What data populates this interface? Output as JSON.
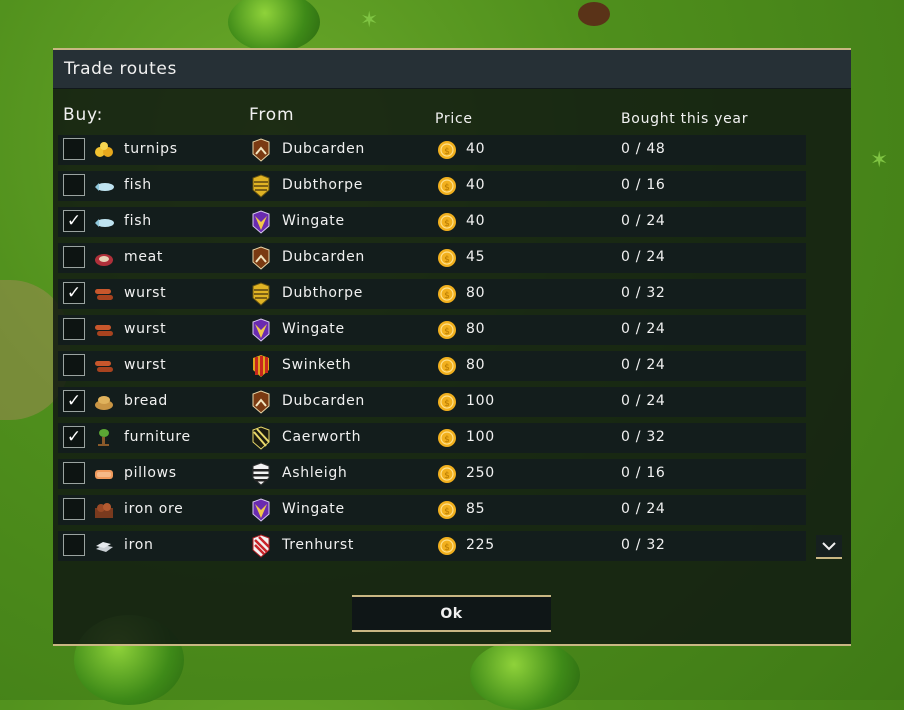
{
  "dialog": {
    "title": "Trade routes",
    "ok_label": "Ok"
  },
  "headers": {
    "buy": "Buy:",
    "from": "From",
    "price": "Price",
    "bought": "Bought this year"
  },
  "routes": [
    {
      "checked": false,
      "ware": "turnips",
      "ware_icon": "turnips-icon",
      "city": "Dubcarden",
      "crest": "dubcarden-crest",
      "price": "40",
      "bought": "0 / 48"
    },
    {
      "checked": false,
      "ware": "fish",
      "ware_icon": "fish-icon",
      "city": "Dubthorpe",
      "crest": "dubthorpe-crest",
      "price": "40",
      "bought": "0 / 16"
    },
    {
      "checked": true,
      "ware": "fish",
      "ware_icon": "fish-icon",
      "city": "Wingate",
      "crest": "wingate-crest",
      "price": "40",
      "bought": "0 / 24"
    },
    {
      "checked": false,
      "ware": "meat",
      "ware_icon": "meat-icon",
      "city": "Dubcarden",
      "crest": "dubcarden-crest",
      "price": "45",
      "bought": "0 / 24"
    },
    {
      "checked": true,
      "ware": "wurst",
      "ware_icon": "wurst-icon",
      "city": "Dubthorpe",
      "crest": "dubthorpe-crest",
      "price": "80",
      "bought": "0 / 32"
    },
    {
      "checked": false,
      "ware": "wurst",
      "ware_icon": "wurst-icon",
      "city": "Wingate",
      "crest": "wingate-crest",
      "price": "80",
      "bought": "0 / 24"
    },
    {
      "checked": false,
      "ware": "wurst",
      "ware_icon": "wurst-icon",
      "city": "Swinketh",
      "crest": "swinketh-crest",
      "price": "80",
      "bought": "0 / 24"
    },
    {
      "checked": true,
      "ware": "bread",
      "ware_icon": "bread-icon",
      "city": "Dubcarden",
      "crest": "dubcarden-crest",
      "price": "100",
      "bought": "0 / 24"
    },
    {
      "checked": true,
      "ware": "furniture",
      "ware_icon": "furniture-icon",
      "city": "Caerworth",
      "crest": "caerworth-crest",
      "price": "100",
      "bought": "0 / 32"
    },
    {
      "checked": false,
      "ware": "pillows",
      "ware_icon": "pillows-icon",
      "city": "Ashleigh",
      "crest": "ashleigh-crest",
      "price": "250",
      "bought": "0 / 16"
    },
    {
      "checked": false,
      "ware": "iron ore",
      "ware_icon": "iron-ore-icon",
      "city": "Wingate",
      "crest": "wingate-crest",
      "price": "85",
      "bought": "0 / 24"
    },
    {
      "checked": false,
      "ware": "iron",
      "ware_icon": "iron-icon",
      "city": "Trenhurst",
      "crest": "trenhurst-crest",
      "price": "225",
      "bought": "0 / 32"
    }
  ],
  "colors": {
    "accent_gold": "#c9b783",
    "coin": "#f2b01e",
    "panel": "#131d1c"
  }
}
